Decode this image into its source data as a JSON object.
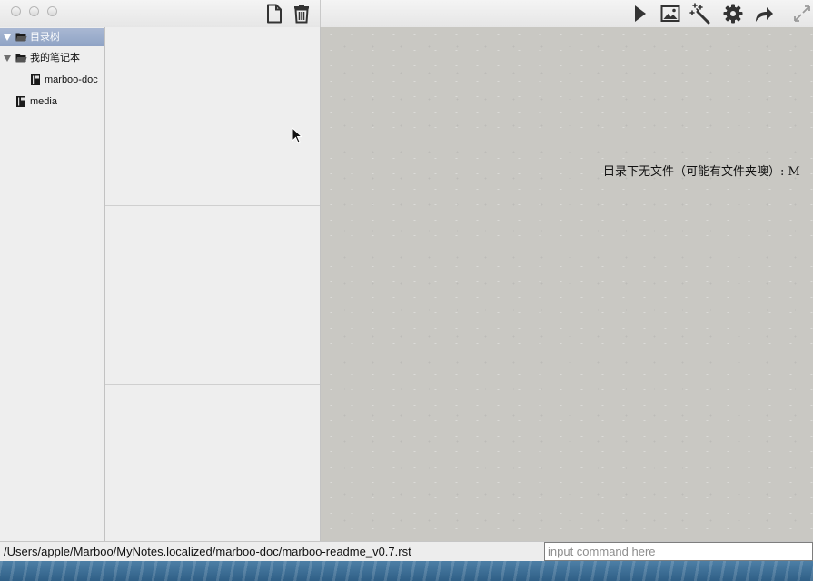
{
  "toolbar": {
    "buttons": [
      {
        "name": "new-file",
        "icon": "new-file-icon"
      },
      {
        "name": "delete",
        "icon": "trash-icon"
      },
      {
        "name": "preview",
        "icon": "play-icon"
      },
      {
        "name": "insert-image",
        "icon": "image-icon"
      },
      {
        "name": "magic",
        "icon": "magic-wand-icon"
      },
      {
        "name": "settings",
        "icon": "gear-icon"
      },
      {
        "name": "share",
        "icon": "share-arrow-icon"
      },
      {
        "name": "fullscreen",
        "icon": "expand-icon"
      }
    ]
  },
  "sidebar": {
    "items": [
      {
        "label": "目录树",
        "type": "folder",
        "expanded": true,
        "selected": true
      },
      {
        "label": "我的笔记本",
        "type": "folder",
        "expanded": true,
        "selected": false
      },
      {
        "label": "marboo-doc",
        "type": "notebook",
        "selected": false
      },
      {
        "label": "media",
        "type": "notebook",
        "selected": false
      }
    ]
  },
  "main": {
    "message": "目录下无文件（可能有文件夹噢）: M"
  },
  "status": {
    "path": "/Users/apple/Marboo/MyNotes.localized/marboo-doc/marboo-readme_v0.7.rst",
    "command_placeholder": "input command here",
    "command_value": ""
  },
  "colors": {
    "selection": "#9aaecb",
    "content_bg": "#c9c8c3",
    "pane_bg": "#eeeeee"
  }
}
